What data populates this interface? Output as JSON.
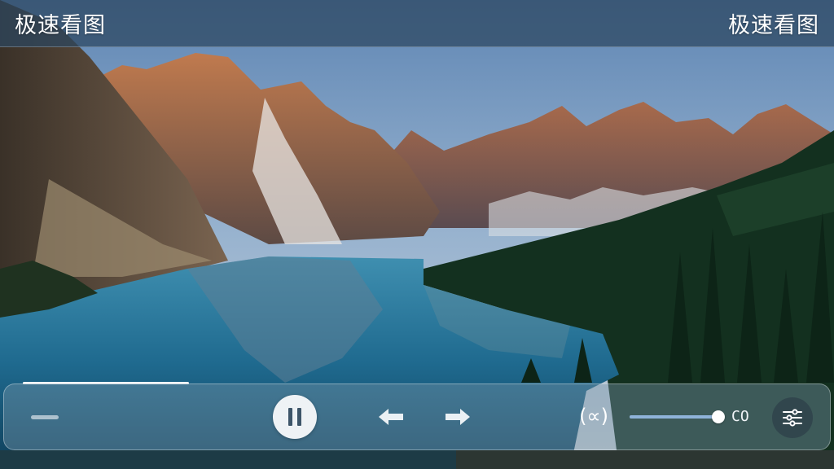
{
  "header": {
    "title_left": "极速看图",
    "title_right": "极速看图"
  },
  "playback": {
    "progress": 0.21,
    "state": "playing"
  },
  "controls": {
    "proportion_symbol": "(∝)",
    "slider_value_fraction": 0.97,
    "slider_value_label": "CO"
  },
  "icons": {
    "minus": "minus-icon",
    "pause": "pause-icon",
    "prev": "arrow-left-icon",
    "next": "arrow-right-icon",
    "settings": "sliders-icon"
  },
  "colors": {
    "accent": "#8fb3d9",
    "panel": "#789aaa",
    "pause_glyph": "#3d5569"
  }
}
